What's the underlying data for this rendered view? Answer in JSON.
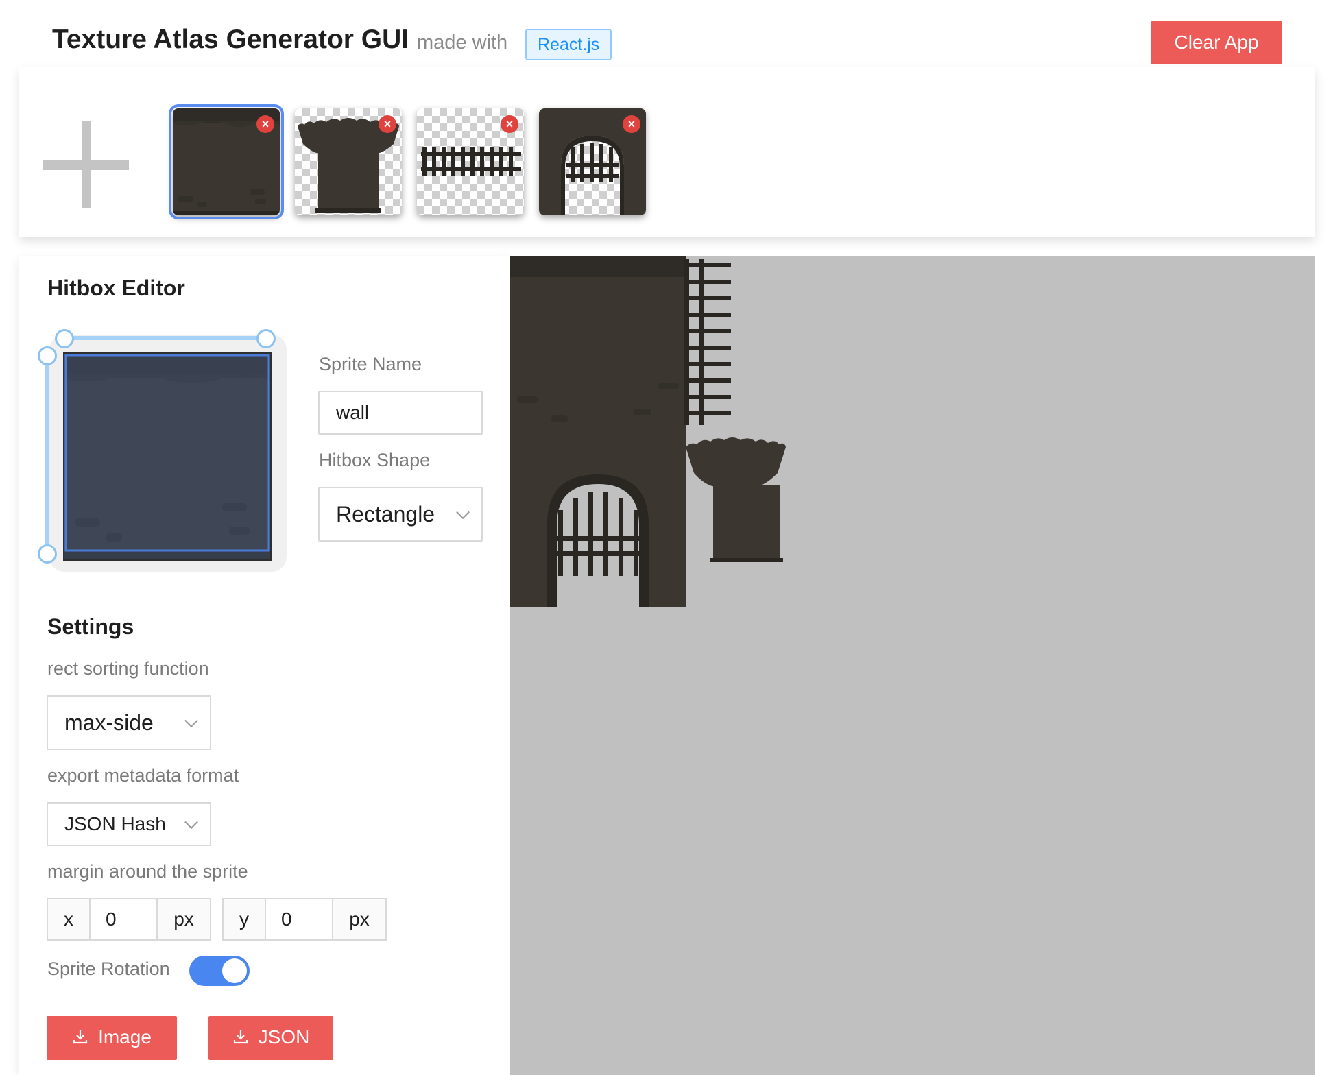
{
  "header": {
    "title": "Texture Atlas Generator GUI",
    "made_with": "made with",
    "framework_tag": "React.js",
    "clear_button": "Clear App"
  },
  "sprites": [
    {
      "name": "wall",
      "selected": true
    },
    {
      "name": "tower",
      "selected": false
    },
    {
      "name": "fence",
      "selected": false
    },
    {
      "name": "gate",
      "selected": false
    }
  ],
  "hitbox_editor": {
    "title": "Hitbox Editor",
    "sprite_name_label": "Sprite Name",
    "sprite_name_value": "wall",
    "hitbox_shape_label": "Hitbox Shape",
    "hitbox_shape_value": "Rectangle"
  },
  "settings": {
    "title": "Settings",
    "sorting_label": "rect sorting function",
    "sorting_value": "max-side",
    "export_label": "export metadata format",
    "export_value": "JSON Hash",
    "margin_label": "margin around the sprite",
    "margin_x_prefix": "x",
    "margin_x_value": "0",
    "margin_x_suffix": "px",
    "margin_y_prefix": "y",
    "margin_y_value": "0",
    "margin_y_suffix": "px",
    "rotation_label": "Sprite Rotation",
    "rotation_enabled": true,
    "download_image": "Image",
    "download_json": "JSON"
  },
  "colors": {
    "accent_red": "#ec5b57",
    "accent_blue": "#4a86f0",
    "sprite_dark": "#3b3630",
    "canvas_bg": "#c0c0c0"
  }
}
